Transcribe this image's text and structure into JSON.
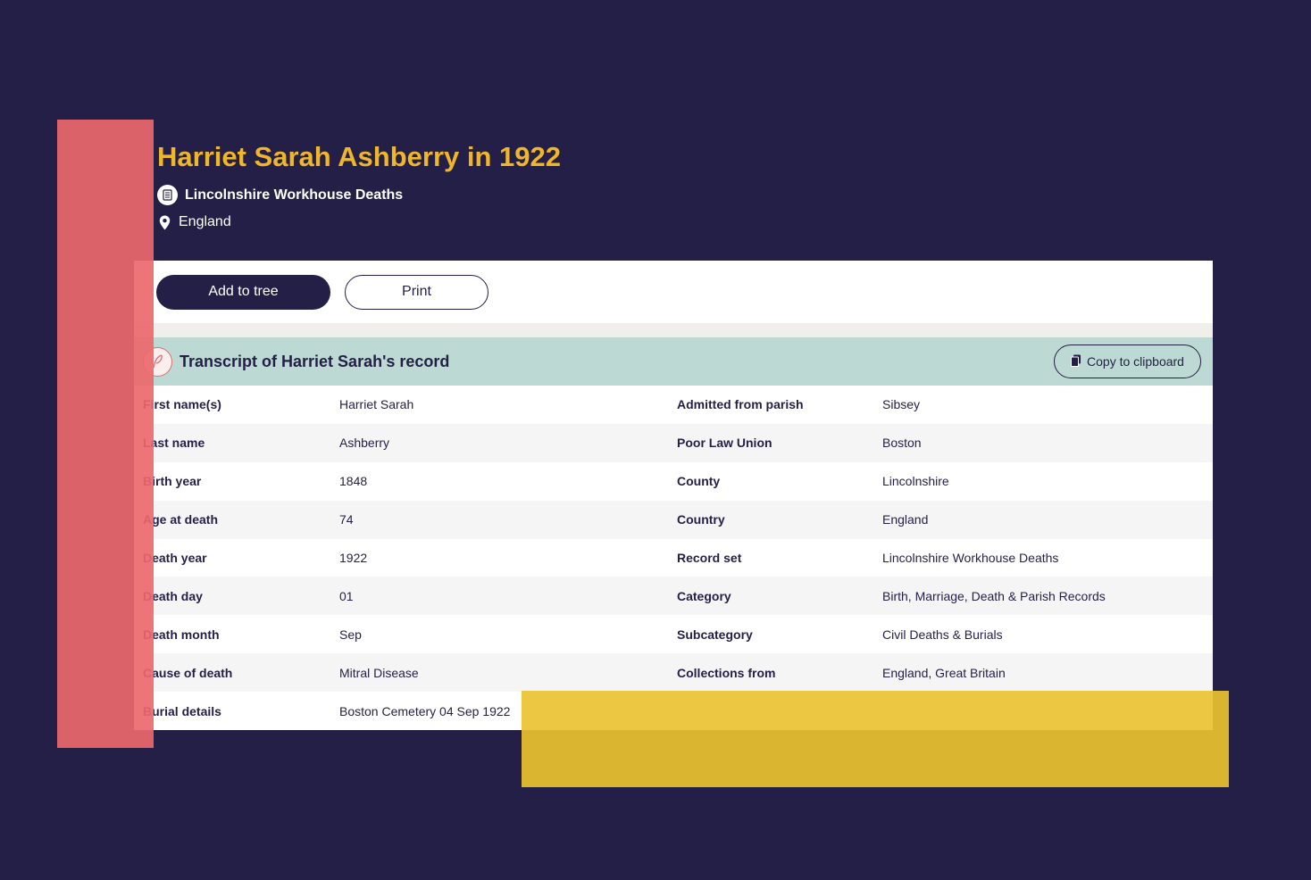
{
  "page": {
    "title": "Harriet Sarah Ashberry in 1922",
    "record_set": "Lincolnshire Workhouse Deaths",
    "location": "England"
  },
  "toolbar": {
    "add_to_tree_label": "Add to tree",
    "print_label": "Print"
  },
  "transcript": {
    "title": "Transcript of Harriet Sarah's record",
    "copy_label": "Copy to clipboard",
    "rows": [
      {
        "label_left": "First name(s)",
        "value_left": "Harriet Sarah",
        "label_right": "Admitted from parish",
        "value_right": "Sibsey"
      },
      {
        "label_left": "Last name",
        "value_left": "Ashberry",
        "label_right": "Poor Law Union",
        "value_right": "Boston"
      },
      {
        "label_left": "Birth year",
        "value_left": "1848",
        "label_right": "County",
        "value_right": "Lincolnshire"
      },
      {
        "label_left": "Age at death",
        "value_left": "74",
        "label_right": "Country",
        "value_right": "England"
      },
      {
        "label_left": "Death year",
        "value_left": "1922",
        "label_right": "Record set",
        "value_right": "Lincolnshire Workhouse Deaths"
      },
      {
        "label_left": "Death day",
        "value_left": "01",
        "label_right": "Category",
        "value_right": "Birth, Marriage, Death & Parish Records"
      },
      {
        "label_left": "Death month",
        "value_left": "Sep",
        "label_right": "Subcategory",
        "value_right": "Civil Deaths & Burials"
      },
      {
        "label_left": "Cause of death",
        "value_left": "Mitral Disease",
        "label_right": "Collections from",
        "value_right": "England, Great Britain"
      },
      {
        "label_left": "Burial details",
        "value_left": "Boston Cemetery 04 Sep 1922",
        "label_right": "",
        "value_right": ""
      }
    ]
  },
  "icons": {
    "record_set": "document-icon",
    "location": "location-pin-icon",
    "transcript": "quill-icon",
    "copy": "clipboard-icon"
  },
  "colors": {
    "background": "#241f47",
    "title": "#f0b62a",
    "transcript_header": "#bdd9d3",
    "accent_red": "#ec686c",
    "accent_yellow": "#dab52f"
  }
}
